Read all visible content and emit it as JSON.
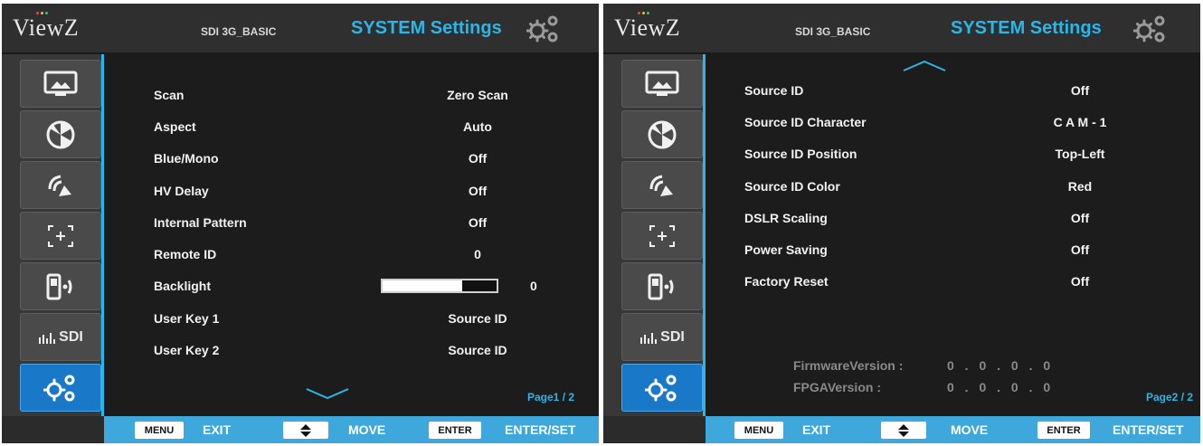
{
  "brand": {
    "logo_text": "ViewZ",
    "dot_colors": [
      "#e84c3d",
      "#f1c40f",
      "#2ecc71",
      "#3498db"
    ]
  },
  "colors": {
    "accent": "#29b6e8",
    "active_tab": "#1a78c8",
    "footer": "#3ea8dc",
    "background": "#1c1c1c"
  },
  "sidebar_icons": [
    "monitor-icon",
    "color-wheel-icon",
    "signal-icon",
    "focus-icon",
    "remote-icon",
    "sdi-icon",
    "settings-icon"
  ],
  "panels": [
    {
      "model": "SDI 3G_BASIC",
      "title": "SYSTEM Settings",
      "sidebar": {
        "sdi_label": "SDI"
      },
      "scroll_indicator": "down",
      "rows": [
        {
          "label": "Scan",
          "value": "Zero Scan"
        },
        {
          "label": "Aspect",
          "value": "Auto"
        },
        {
          "label": "Blue/Mono",
          "value": "Off"
        },
        {
          "label": "HV Delay",
          "value": "Off"
        },
        {
          "label": "Internal Pattern",
          "value": "Off"
        },
        {
          "label": "Remote ID",
          "value": "0"
        },
        {
          "label": "Backlight",
          "value": "0",
          "level_fraction": 0.7
        },
        {
          "label": "User Key 1",
          "value": "Source ID"
        },
        {
          "label": "User Key 2",
          "value": "Source ID"
        }
      ],
      "page": "Page1 / 2",
      "footer": {
        "menu_key": "MENU",
        "exit": "EXIT",
        "move_key": "◆",
        "move": "MOVE",
        "enter_key": "ENTER",
        "enter_set": "ENTER/SET"
      }
    },
    {
      "model": "SDI 3G_BASIC",
      "title": "SYSTEM Settings",
      "sidebar": {
        "sdi_label": "SDI"
      },
      "scroll_indicator": "up",
      "rows": [
        {
          "label": "Source ID",
          "value": "Off"
        },
        {
          "label": "Source ID Character",
          "value": "C A M - 1"
        },
        {
          "label": "Source ID Position",
          "value": "Top-Left"
        },
        {
          "label": "Source ID Color",
          "value": "Red"
        },
        {
          "label": "DSLR Scaling",
          "value": "Off"
        },
        {
          "label": "Power Saving",
          "value": "Off"
        },
        {
          "label": "Factory Reset",
          "value": "Off"
        }
      ],
      "firmware": {
        "label": "FirmwareVersion :",
        "value": "0 . 0 . 0 . 0"
      },
      "fpga": {
        "label": "FPGAVersion :",
        "value": "0 . 0 . 0 . 0"
      },
      "page": "Page2 / 2",
      "footer": {
        "menu_key": "MENU",
        "exit": "EXIT",
        "move_key": "◆",
        "move": "MOVE",
        "enter_key": "ENTER",
        "enter_set": "ENTER/SET"
      }
    }
  ]
}
